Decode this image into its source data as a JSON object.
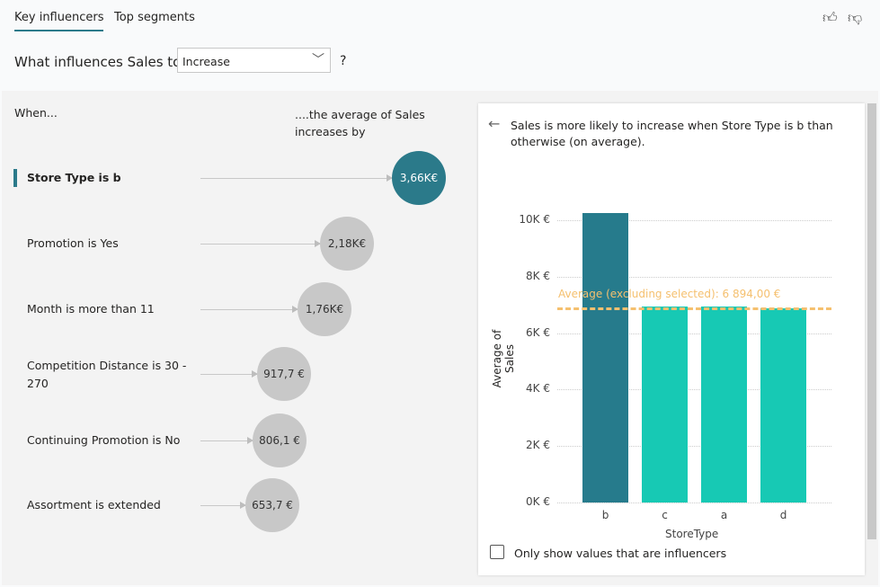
{
  "tabs": [
    {
      "label": "Key influencers",
      "active": true
    },
    {
      "label": "Top segments",
      "active": false
    }
  ],
  "question": {
    "prefix": "What influences Sales to",
    "selected": "Increase",
    "suffix": "?"
  },
  "columns": {
    "when": "When...",
    "effect": "....the average of Sales increases by"
  },
  "influencers": [
    {
      "label": "Store Type is b",
      "value": "3,66K€",
      "selected": true
    },
    {
      "label": "Promotion is Yes",
      "value": "2,18K€",
      "selected": false
    },
    {
      "label": "Month is more than 11",
      "value": "1,76K€",
      "selected": false
    },
    {
      "label": "Competition Distance is 30 - 270",
      "value": "917,7 €",
      "selected": false
    },
    {
      "label": "Continuing Promotion is No",
      "value": "806,1 €",
      "selected": false
    },
    {
      "label": "Assortment is extended",
      "value": "653,7 €",
      "selected": false
    }
  ],
  "detail": {
    "text": "Sales is more likely to increase when Store Type is b than otherwise (on average).",
    "checkbox_label": "Only show values that are influencers",
    "checkbox_checked": false
  },
  "colors": {
    "accent": "#2b7a8a",
    "bar_selected": "#267b8c",
    "bar_other": "#17c9b4",
    "average": "#f5c06f",
    "bubble_grey": "#c8c8c8"
  },
  "chart_data": {
    "type": "bar",
    "categories": [
      "b",
      "c",
      "a",
      "d"
    ],
    "values": [
      10250,
      6940,
      6940,
      6880
    ],
    "xlabel": "StoreType",
    "ylabel": "Average of Sales",
    "yticks": [
      "0K €",
      "2K €",
      "4K €",
      "6K €",
      "8K €",
      "10K €"
    ],
    "ylim": [
      0,
      10000
    ],
    "average": {
      "label": "Average (excluding selected): 6 894,00 €",
      "value": 6894
    },
    "selected": "b"
  }
}
